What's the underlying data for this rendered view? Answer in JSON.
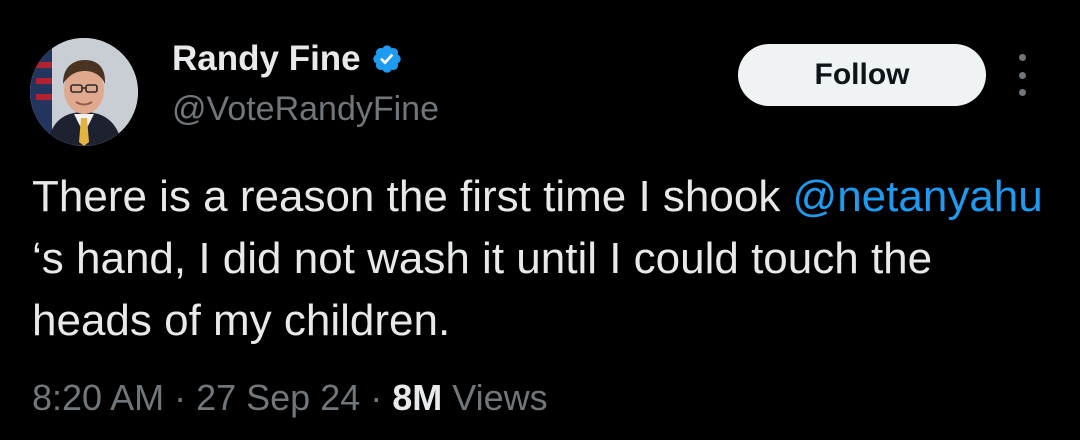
{
  "author": {
    "display_name": "Randy Fine",
    "handle": "@VoteRandyFine",
    "verified": true,
    "avatar_icon": "profile-photo"
  },
  "actions": {
    "follow_label": "Follow",
    "more_icon": "more-vertical-icon"
  },
  "tweet": {
    "text_part1": "There is a reason the first time I shook ",
    "mention": "@netanyahu",
    "text_part2": " ‘s hand, I did not wash it until I could touch the heads of my children."
  },
  "meta": {
    "time": "8:20 AM",
    "separator": " · ",
    "date": "27 Sep 24",
    "views_count": "8M",
    "views_label": " Views"
  },
  "colors": {
    "background": "#000000",
    "text_primary": "#e7e9ea",
    "text_secondary": "#71767b",
    "accent_blue": "#1d9bf0",
    "button_bg": "#eff3f4"
  }
}
